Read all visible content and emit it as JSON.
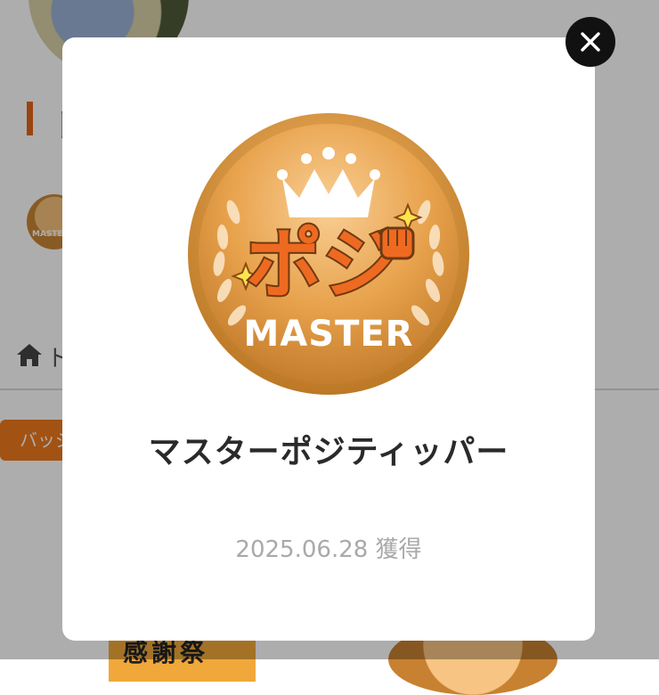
{
  "background": {
    "section_title": "ト",
    "badge_thumb_text": "MASTER",
    "breadcrumb": "ト",
    "tab_label": "バッジ",
    "card_left_text": "感謝祭"
  },
  "modal": {
    "medal": {
      "logo_text": "ポジ",
      "label": "MASTER",
      "icons": [
        "crown-icon",
        "laurel-icon",
        "sparkle-icon",
        "fist-icon"
      ]
    },
    "badge_name": "マスターポジティッパー",
    "acquired_date": "2025.06.28 獲得",
    "close_icon": "close-icon"
  },
  "colors": {
    "accent": "#e3651a",
    "medal_gold": "#e8a24c",
    "medal_dark": "#b46f25",
    "logo_orange": "#ef6a21"
  }
}
